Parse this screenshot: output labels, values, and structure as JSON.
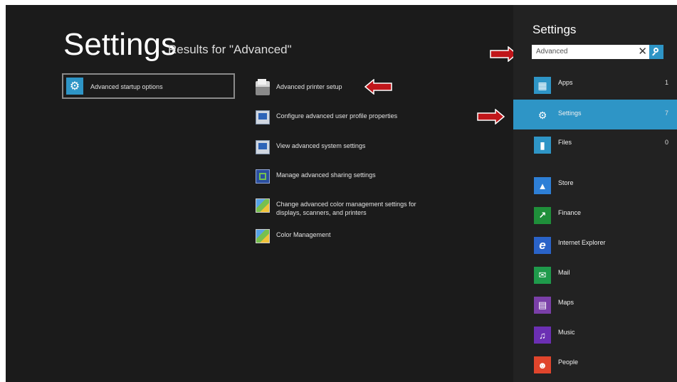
{
  "main": {
    "title": "Settings",
    "subtitle": "Results for \"Advanced\"",
    "featured_result": {
      "label": "Advanced startup options",
      "icon": "gear-icon"
    },
    "results": [
      {
        "label": "Advanced printer setup",
        "icon": "printer-icon"
      },
      {
        "label": "Configure advanced user profile properties",
        "icon": "system-monitor-icon"
      },
      {
        "label": "View advanced system settings",
        "icon": "system-monitor-icon"
      },
      {
        "label": "Manage advanced sharing settings",
        "icon": "network-icon"
      },
      {
        "label": "Change advanced color management settings for displays, scanners, and printers",
        "icon": "color-management-icon"
      },
      {
        "label": "Color Management",
        "icon": "color-management-icon"
      }
    ]
  },
  "pane": {
    "title": "Settings",
    "search": {
      "value": "Advanced",
      "clear_glyph": "✕"
    },
    "scopes": [
      {
        "label": "Apps",
        "count": "1",
        "icon": "apps-icon",
        "color": "#2e95c6"
      },
      {
        "label": "Settings",
        "count": "7",
        "icon": "gear-icon",
        "color": "#2e95c6",
        "selected": true
      },
      {
        "label": "Files",
        "count": "0",
        "icon": "file-icon",
        "color": "#2e95c6"
      }
    ],
    "apps": [
      {
        "label": "Store",
        "icon": "store-icon",
        "color": "#2e7fd6"
      },
      {
        "label": "Finance",
        "icon": "finance-icon",
        "color": "#1f8f3a"
      },
      {
        "label": "Internet Explorer",
        "icon": "internet-explorer-icon",
        "color": "#2a63c8"
      },
      {
        "label": "Mail",
        "icon": "mail-icon",
        "color": "#1f9a4b"
      },
      {
        "label": "Maps",
        "icon": "maps-icon",
        "color": "#7a3fa8"
      },
      {
        "label": "Music",
        "icon": "music-icon",
        "color": "#6b2fb3"
      },
      {
        "label": "People",
        "icon": "people-icon",
        "color": "#e0452c"
      }
    ]
  },
  "colors": {
    "accent": "#2e95c6",
    "annotation_arrow": "#c0161a",
    "background": "#1b1b1b",
    "pane": "#222222"
  }
}
